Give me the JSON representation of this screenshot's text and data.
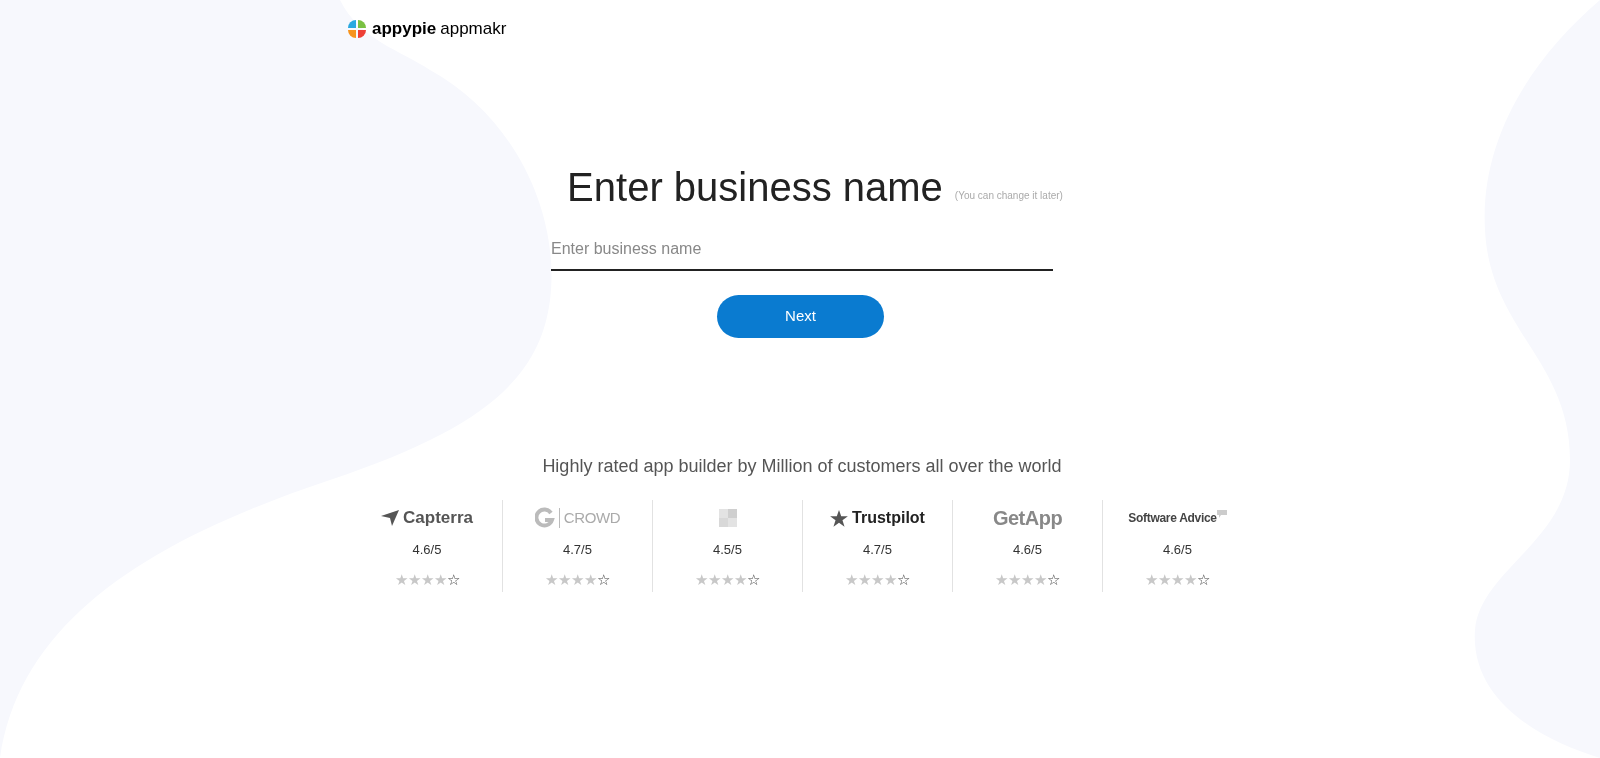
{
  "brand": {
    "name": "appypie",
    "product": "appmakr"
  },
  "heading": {
    "title": "Enter business name",
    "note": "(You can change it later)"
  },
  "business_name_field": {
    "placeholder": "Enter business name"
  },
  "next_button": {
    "label": "Next"
  },
  "ratings": {
    "tagline": "Highly rated app builder by Million of customers all over the world",
    "items": [
      {
        "kind": "capterra",
        "logo": "Capterra",
        "score": "4.6/5",
        "stars": 4
      },
      {
        "kind": "g2",
        "logo": "CROWD",
        "score": "4.7/5",
        "stars": 4
      },
      {
        "kind": "blank",
        "score": "4.5/5",
        "stars": 4
      },
      {
        "kind": "trustpilot",
        "logo": "Trustpilot",
        "score": "4.7/5",
        "stars": 4
      },
      {
        "kind": "getapp",
        "logo": "GetApp",
        "score": "4.6/5",
        "stars": 4
      },
      {
        "kind": "softwareadvice",
        "logo": "Software Advice",
        "score": "4.6/5",
        "stars": 4
      }
    ]
  }
}
